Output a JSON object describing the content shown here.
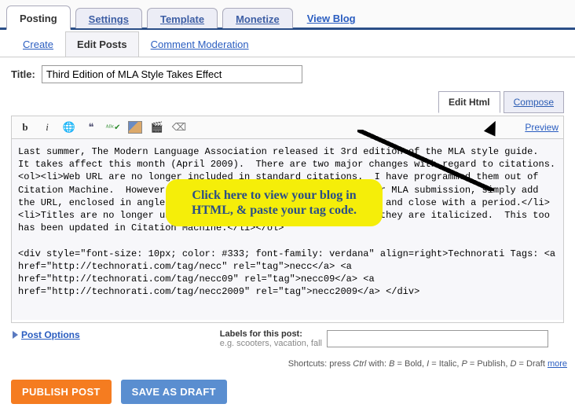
{
  "primaryTabs": {
    "posting": "Posting",
    "settings": "Settings",
    "template": "Template",
    "monetize": "Monetize",
    "viewBlog": "View Blog"
  },
  "subTabs": {
    "create": "Create",
    "editPosts": "Edit Posts",
    "commentModeration": "Comment Moderation"
  },
  "title": {
    "label": "Title:",
    "value": "Third Edition of MLA Style Takes Effect"
  },
  "editorTabs": {
    "editHtml": "Edit Html",
    "compose": "Compose"
  },
  "preview": "Preview",
  "editorContent": "Last summer, The Modern Language Association released it 3rd edition of the MLA style guide.  It takes affect this month (April 2009).  There are two major changes with regard to citations.\n<ol><li>Web URL are no longer included in standard citations.  I have programmed them out of Citation Machine.  However, if your instructor wants them in your MLA submission, simply add the URL, enclosed in angled brackets, to the end of the citation and close with a period.</li><li>Titles are no longer underlined in the citations.  Instead, they are italicized.  This too has been updated in Citation Machine.</li></ol>\n\n<div style=\"font-size: 10px; color: #333; font-family: verdana\" align=right>Technorati Tags: <a href=\"http://technorati.com/tag/necc\" rel=\"tag\">necc</a> <a href=\"http://technorati.com/tag/necc09\" rel=\"tag\">necc09</a> <a href=\"http://technorati.com/tag/necc2009\" rel=\"tag\">necc2009</a> </div>",
  "callout": "Click here to view your blog in HTML, & paste your tag code.",
  "postOptions": "Post Options",
  "labels": {
    "label": "Labels for this post:",
    "hint": "e.g. scooters, vacation, fall",
    "value": ""
  },
  "shortcuts": {
    "prefix": "Shortcuts: press ",
    "ctrl": "Ctrl",
    "withText": " with: ",
    "b": "B",
    "bDesc": " = Bold, ",
    "i": "I",
    "iDesc": " = Italic, ",
    "p": "P",
    "pDesc": " = Publish, ",
    "d": "D",
    "dDesc": " = Draft ",
    "more": "more"
  },
  "buttons": {
    "publish": "PUBLISH POST",
    "draft": "SAVE AS DRAFT"
  }
}
